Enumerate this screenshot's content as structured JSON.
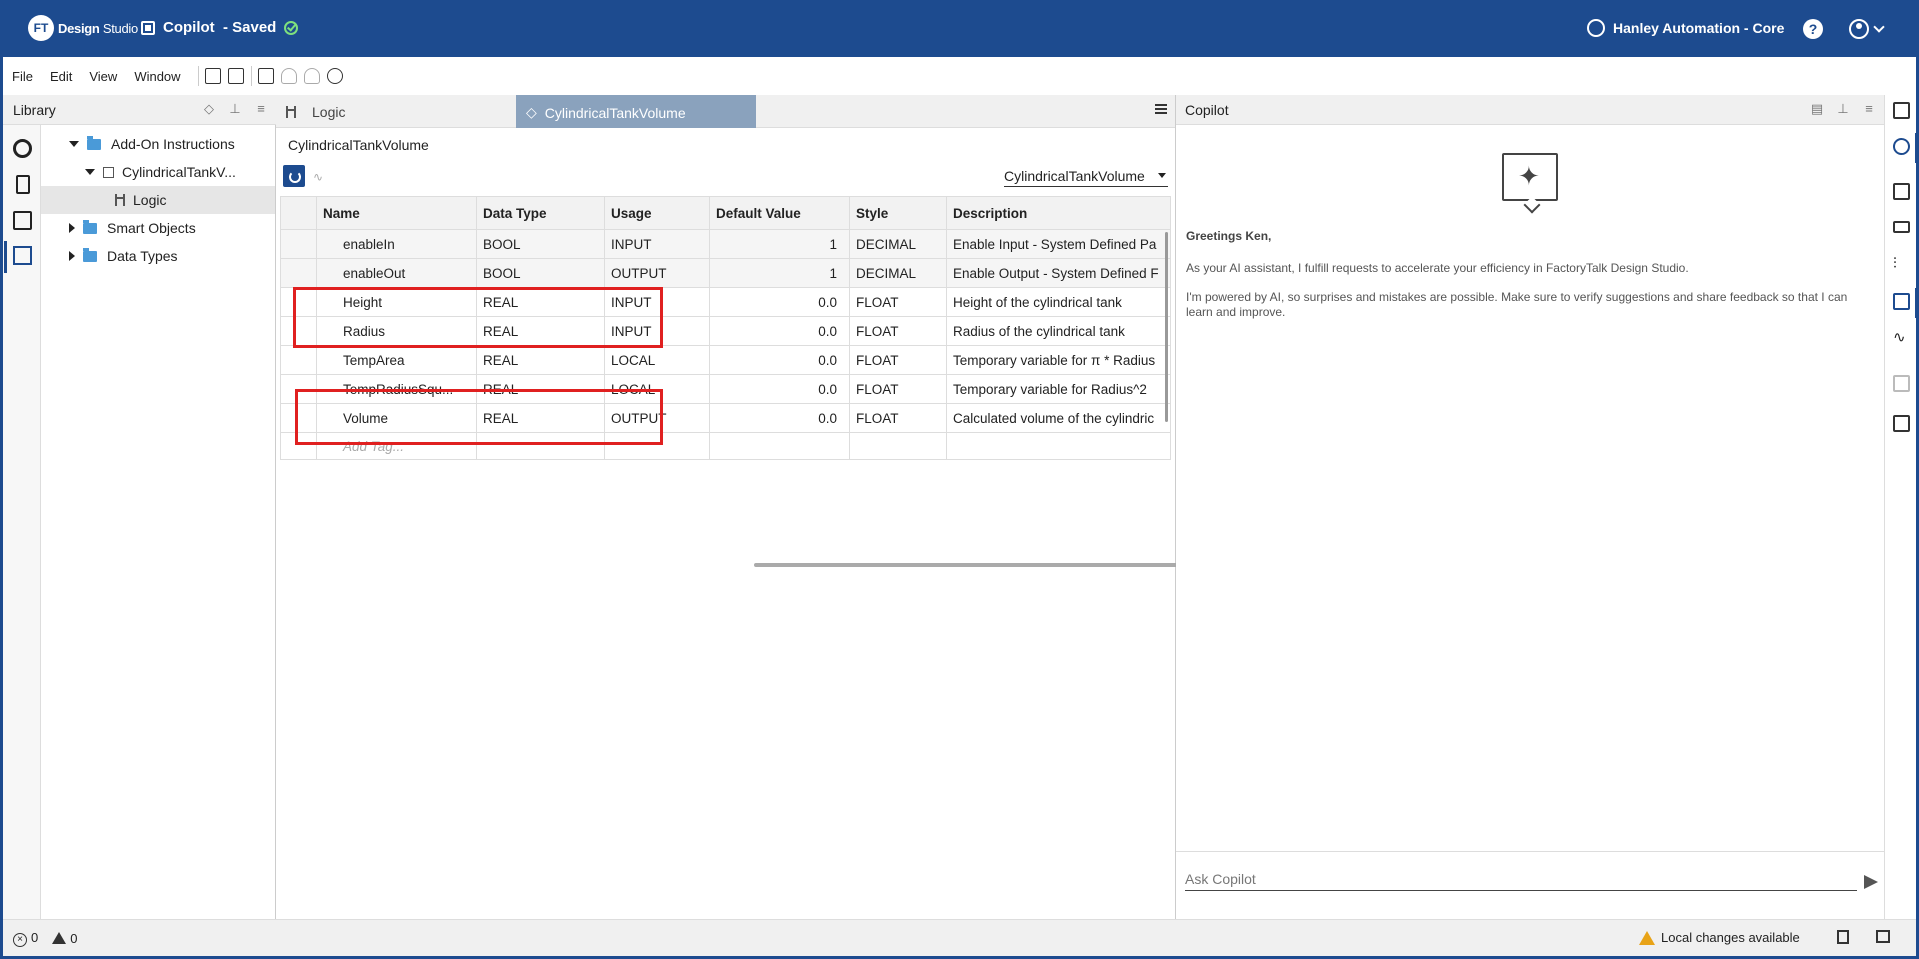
{
  "header": {
    "logo_badge": "FT",
    "logo_bold": "Design",
    "logo_rest": " Studio",
    "doc_title": "Copilot  - Saved",
    "org_name": "Hanley Automation - Core",
    "help_glyph": "?"
  },
  "menu": [
    "File",
    "Edit",
    "View",
    "Window"
  ],
  "library": {
    "title": "Library",
    "tree": [
      {
        "label": "Add-On Instructions"
      },
      {
        "label": "CylindricalTankV..."
      },
      {
        "label": "Logic"
      },
      {
        "label": "Smart Objects"
      },
      {
        "label": "Data Types"
      }
    ]
  },
  "editor": {
    "tabs": [
      {
        "label": "Logic"
      },
      {
        "label": "CylindricalTankVolume"
      }
    ],
    "breadcrumb": "CylindricalTankVolume",
    "scope_value": "CylindricalTankVolume",
    "columns": [
      "Name",
      "Data Type",
      "Usage",
      "Default Value",
      "Style",
      "Description"
    ],
    "rows": [
      {
        "name": "enableIn",
        "type": "BOOL",
        "usage": "INPUT",
        "default": "1",
        "style": "DECIMAL",
        "desc": "Enable Input - System Defined Pa",
        "system": true
      },
      {
        "name": "enableOut",
        "type": "BOOL",
        "usage": "OUTPUT",
        "default": "1",
        "style": "DECIMAL",
        "desc": "Enable Output - System Defined F",
        "system": true
      },
      {
        "name": "Height",
        "type": "REAL",
        "usage": "INPUT",
        "default": "0.0",
        "style": "FLOAT",
        "desc": "Height of the cylindrical tank"
      },
      {
        "name": "Radius",
        "type": "REAL",
        "usage": "INPUT",
        "default": "0.0",
        "style": "FLOAT",
        "desc": "Radius of the cylindrical tank"
      },
      {
        "name": "TempArea",
        "type": "REAL",
        "usage": "LOCAL",
        "default": "0.0",
        "style": "FLOAT",
        "desc": "Temporary variable for π * Radius"
      },
      {
        "name": "TempRadiusSqu...",
        "type": "REAL",
        "usage": "LOCAL",
        "default": "0.0",
        "style": "FLOAT",
        "desc": "Temporary variable for Radius^2"
      },
      {
        "name": "Volume",
        "type": "REAL",
        "usage": "OUTPUT",
        "default": "0.0",
        "style": "FLOAT",
        "desc": "Calculated volume of the cylindric"
      }
    ],
    "add_tag_placeholder": "Add Tag..."
  },
  "copilot": {
    "title": "Copilot",
    "greeting": "Greetings Ken,",
    "intro": "As your AI assistant, I fulfill requests to accelerate your efficiency in FactoryTalk Design Studio.",
    "disclaimer": "I'm powered by AI, so surprises and mistakes are possible. Make sure to verify suggestions and share feedback so that I can learn and improve.",
    "input_placeholder": "Ask Copilot"
  },
  "status": {
    "errors": "0",
    "warnings": "0",
    "local_changes": "Local changes available"
  },
  "colors": {
    "brand": "#1d4b8f",
    "highlight": "#e02020",
    "warning": "#e8a317"
  }
}
